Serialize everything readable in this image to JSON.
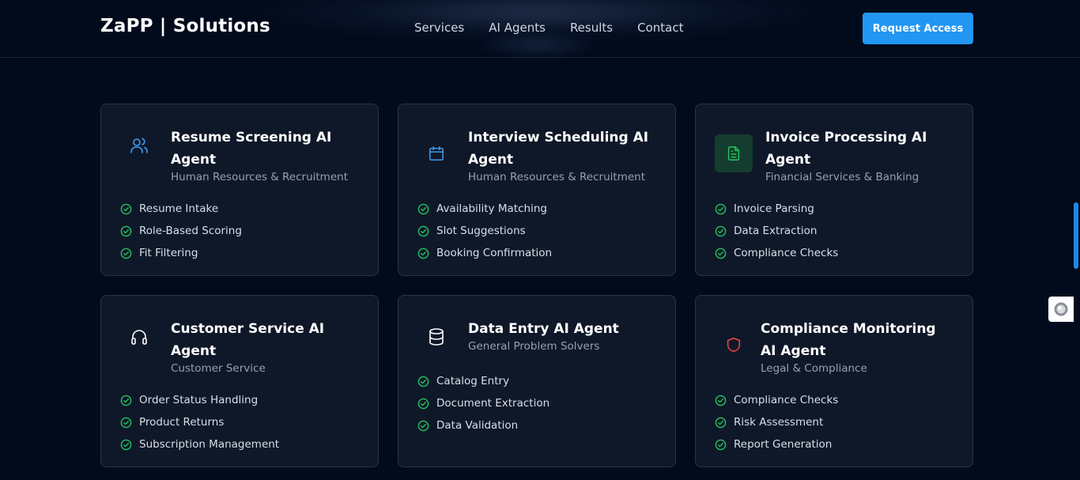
{
  "header": {
    "logo": "ZaPP | Solutions",
    "nav": [
      "Services",
      "AI Agents",
      "Results",
      "Contact"
    ],
    "cta_label": "Request Access",
    "accent_color": "#2196f3"
  },
  "agents": [
    {
      "title": "Resume Screening AI Agent",
      "subtitle": "Human Resources & Recruitment",
      "icon": "users-icon",
      "icon_color": "#3b9ef5",
      "features": [
        "Resume Intake",
        "Role-Based Scoring",
        "Fit Filtering"
      ]
    },
    {
      "title": "Interview Scheduling AI Agent",
      "subtitle": "Human Resources & Recruitment",
      "icon": "calendar-icon",
      "icon_color": "#3b9ef5",
      "features": [
        "Availability Matching",
        "Slot Suggestions",
        "Booking Confirmation"
      ]
    },
    {
      "title": "Invoice Processing AI Agent",
      "subtitle": "Financial Services & Banking",
      "icon": "document-icon",
      "icon_color": "#22c55e",
      "features": [
        "Invoice Parsing",
        "Data Extraction",
        "Compliance Checks"
      ]
    },
    {
      "title": "Customer Service AI Agent",
      "subtitle": "Customer Service",
      "icon": "headphones-icon",
      "icon_color": "#ffffff",
      "features": [
        "Order Status Handling",
        "Product Returns",
        "Subscription Management"
      ]
    },
    {
      "title": "Data Entry AI Agent",
      "subtitle": "General Problem Solvers",
      "icon": "database-icon",
      "icon_color": "#ffffff",
      "features": [
        "Catalog Entry",
        "Document Extraction",
        "Data Validation"
      ]
    },
    {
      "title": "Compliance Monitoring AI Agent",
      "subtitle": "Legal & Compliance",
      "icon": "shield-icon",
      "icon_color": "#ef4444",
      "features": [
        "Compliance Checks",
        "Risk Assessment",
        "Report Generation"
      ]
    }
  ],
  "check_color": "#22c55e"
}
